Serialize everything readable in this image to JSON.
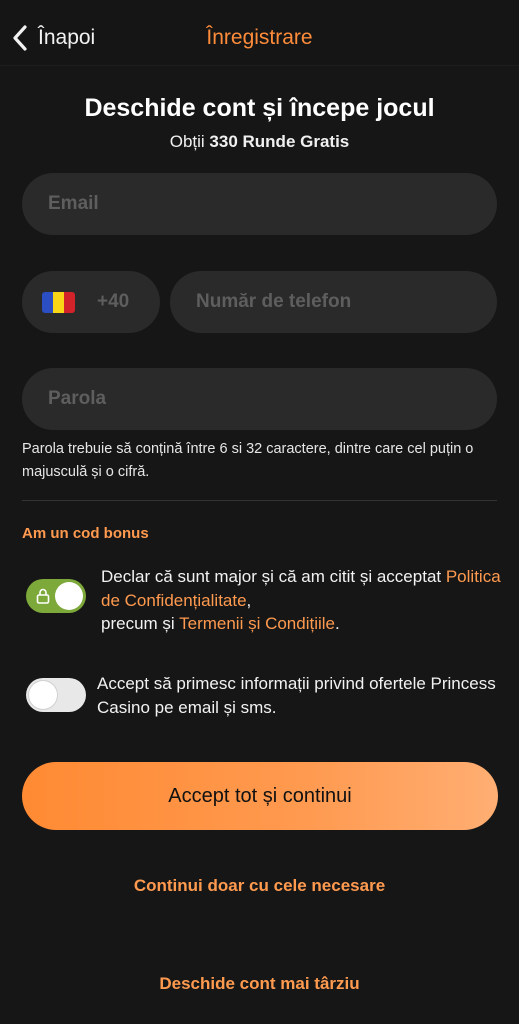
{
  "header": {
    "back_label": "Înapoi",
    "title": "Înregistrare"
  },
  "intro": {
    "headline": "Deschide cont și începe jocul",
    "sub_prefix": "Obții ",
    "sub_bold": "330 Runde Gratis"
  },
  "form": {
    "email_placeholder": "Email",
    "country_prefix": "+40",
    "flag_colors": [
      "#2b4ec2",
      "#f9d616",
      "#d2232a"
    ],
    "phone_placeholder": "Număr de telefon",
    "password_placeholder": "Parola",
    "password_hint": "Parola trebuie să conțină între 6 si 32 caractere, dintre care cel puțin o majusculă și o cifră."
  },
  "bonus_link": "Am un cod bonus",
  "consents": {
    "terms": {
      "checked": true,
      "part1": "Declar că sunt major și că am citit și acceptat ",
      "privacy_link": "Politica de Confidențialitate",
      "part2": ",\nprecum și ",
      "terms_link": "Termenii și Condițiile",
      "part3": "."
    },
    "marketing": {
      "checked": false,
      "text": "Accept să primesc informații privind ofertele Princess Casino pe email și sms."
    }
  },
  "actions": {
    "accept_all": "Accept tot și continui",
    "necessary_only": "Continui doar cu cele necesare",
    "later": "Deschide cont mai târziu"
  },
  "colors": {
    "accent": "#ff9a4f",
    "toggle_on": "#7da83a"
  }
}
